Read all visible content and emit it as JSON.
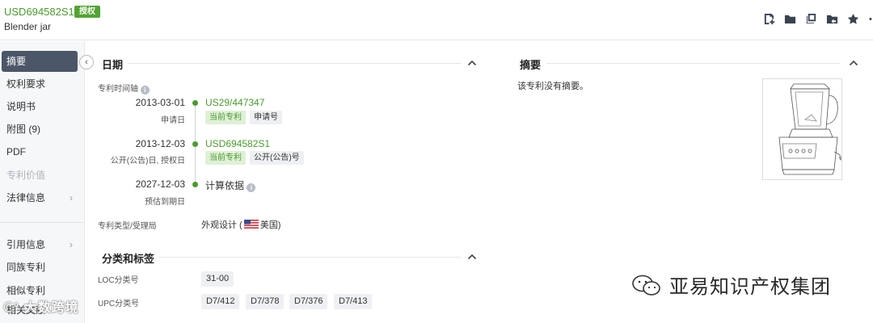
{
  "header": {
    "patent_number": "USD694582S1",
    "status_badge": "授权",
    "title": "Blender jar",
    "toolbar_icons": [
      "note-add-icon",
      "folder-icon",
      "copy-icon",
      "share-folder-icon",
      "star-icon"
    ]
  },
  "sidebar": {
    "items": [
      {
        "label": "摘要",
        "active": true
      },
      {
        "label": "权利要求"
      },
      {
        "label": "说明书"
      },
      {
        "label": "附图 (9)"
      },
      {
        "label": "PDF"
      },
      {
        "label": "专利价值",
        "disabled": true
      },
      {
        "label": "法律信息",
        "has_children": true
      },
      {
        "label": "引用信息",
        "has_children": true
      },
      {
        "label": "同族专利"
      },
      {
        "label": "相似专利"
      },
      {
        "label": "相关文献"
      }
    ]
  },
  "dates_section": {
    "title": "日期",
    "timeline_label": "专利时间轴",
    "events": [
      {
        "date": "2013-03-01",
        "sub": "申请日",
        "value": "US29/447347",
        "tags": [
          "当前专利",
          "申请号"
        ]
      },
      {
        "date": "2013-12-03",
        "sub": "公开(公告)日, 授权日",
        "value": "USD694582S1",
        "tags": [
          "当前专利",
          "公开(公告)号"
        ]
      },
      {
        "date": "2027-12-03",
        "sub": "预估到期日",
        "value": "计算依据",
        "tags": []
      }
    ],
    "type_label": "专利类型/受理局",
    "type_value": "外观设计 (",
    "country": "美国)"
  },
  "classification_section": {
    "title": "分类和标签",
    "loc_label": "LOC分类号",
    "loc_values": [
      "31-00"
    ],
    "upc_label": "UPC分类号",
    "upc_values": [
      "D7/412",
      "D7/378",
      "D7/376",
      "D7/413"
    ]
  },
  "abstract_section": {
    "title": "摘要",
    "text": "该专利没有摘要。"
  },
  "watermarks": {
    "left": "大数跨境",
    "right": "亚易知识产权集团"
  },
  "colors": {
    "accent_green": "#4a9b2f",
    "sidebar_active": "#4b5669"
  }
}
